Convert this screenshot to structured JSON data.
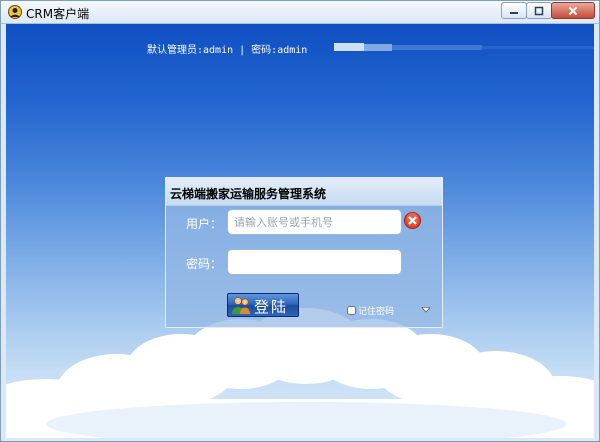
{
  "window": {
    "title": "CRM客户端"
  },
  "header": {
    "hint": "默认管理员:admin | 密码:admin"
  },
  "login": {
    "title": "云梯端搬家运输服务管理系统",
    "user_label": "用户：",
    "user_placeholder": "请输入账号或手机号",
    "user_value": "",
    "password_label": "密码：",
    "password_value": "",
    "login_label": "登陆",
    "remember_label": "记住密码",
    "remember_checked": false
  },
  "colors": {
    "accent": "#2d63b8",
    "clear_icon": "#e0462e"
  }
}
